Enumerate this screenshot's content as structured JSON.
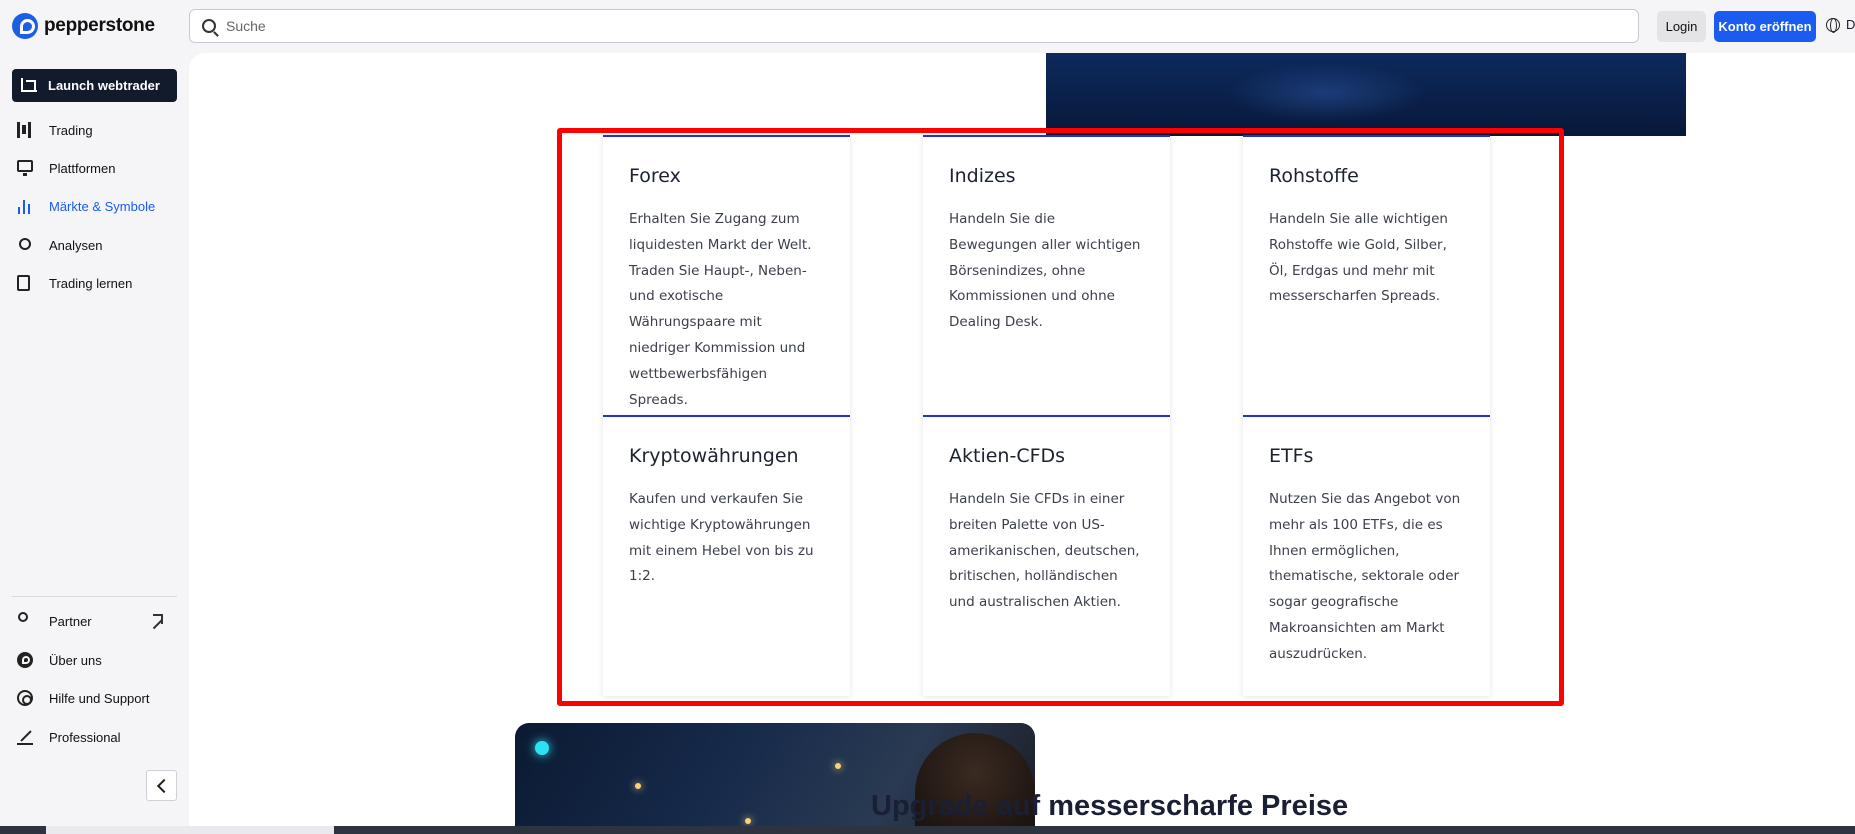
{
  "header": {
    "logo_text": "pepperstone",
    "search_placeholder": "Suche",
    "login_label": "Login",
    "open_account_label": "Konto eröffnen",
    "language_label": "D"
  },
  "sidebar": {
    "launch_label": "Launch webtrader",
    "items": [
      {
        "label": "Trading"
      },
      {
        "label": "Plattformen"
      },
      {
        "label": "Märkte & Symbole"
      },
      {
        "label": "Analysen"
      },
      {
        "label": "Trading lernen"
      }
    ],
    "bottom_items": [
      {
        "label": "Partner"
      },
      {
        "label": "Über uns"
      },
      {
        "label": "Hilfe und Support"
      },
      {
        "label": "Professional"
      }
    ]
  },
  "markets": [
    {
      "title": "Forex",
      "text": "Erhalten Sie Zugang zum liquidesten Markt der Welt. Traden Sie Haupt-, Neben- und exotische Währungspaare mit niedriger Kommission und wettbewerbsfähigen Spreads."
    },
    {
      "title": "Indizes",
      "text": "Handeln Sie die Bewegungen aller wichtigen Börsenindizes, ohne Kommissionen und ohne Dealing Desk."
    },
    {
      "title": "Rohstoffe",
      "text": "Handeln Sie alle wichtigen Rohstoffe wie Gold, Silber, Öl, Erdgas und mehr mit messerscharfen Spreads."
    },
    {
      "title": "Kryptowährungen",
      "text": "Kaufen und verkaufen Sie wichtige Kryptowährungen mit einem Hebel von bis zu 1:2."
    },
    {
      "title": "Aktien-CFDs",
      "text": "Handeln Sie CFDs in einer breiten Palette von US-amerikanischen, deutschen, britischen, holländischen und australischen Aktien."
    },
    {
      "title": "ETFs",
      "text": "Nutzen Sie das Angebot von mehr als 100 ETFs, die es Ihnen ermöglichen, thematische, sektorale oder sogar geografische Makroansichten am Markt auszudrücken."
    }
  ],
  "promo": {
    "title": "Upgrade auf messerscharfe Preise"
  }
}
